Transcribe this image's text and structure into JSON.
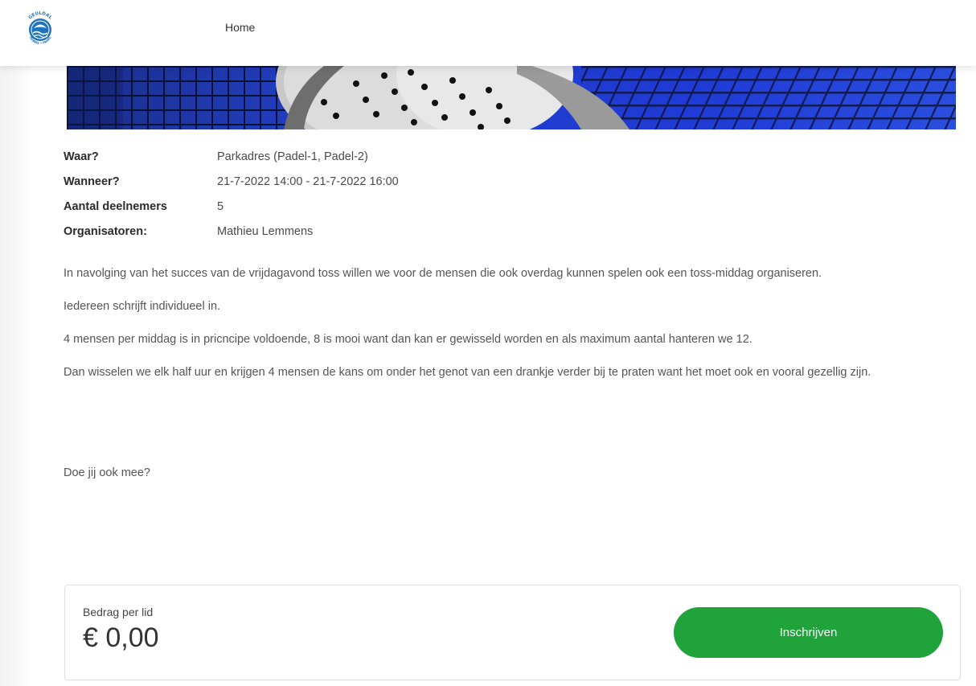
{
  "header": {
    "logo_text_top": "GEULDAL",
    "logo_text_bottom": "TENNIS • PADEL",
    "nav": {
      "home": "Home"
    }
  },
  "hero": {
    "image": "padel-racket-net-photo"
  },
  "details": [
    {
      "label": "Waar?",
      "value": "Parkadres (Padel-1, Padel-2)"
    },
    {
      "label": "Wanneer?",
      "value": "21-7-2022 14:00 - 21-7-2022 16:00"
    },
    {
      "label": "Aantal deelnemers",
      "value": "5"
    },
    {
      "label": "Organisatoren:",
      "value": "Mathieu Lemmens"
    }
  ],
  "description": [
    "In navolging van het succes van de vrijdagavond toss willen we voor de mensen die ook overdag kunnen spelen ook een toss-middag organiseren.",
    "Iedereen schrijft individueel in.",
    "4 mensen per middag is in pricncipe voldoende, 8 is mooi want dan kan er gewisseld worden en als maximum aantal hanteren we 12.",
    "Dan wisselen we elk half uur en krijgen 4 mensen de kans om onder het genot van een drankje verder bij te praten want het moet ook en vooral gezellig zijn."
  ],
  "closing": "Doe jij ook mee?",
  "pricing": {
    "label": "Bedrag per lid",
    "value": "€ 0,00",
    "button": "Inschrijven"
  },
  "colors": {
    "accent_green": "#21a33b",
    "logo_blue": "#1e73be",
    "hero_blue": "#1f3fcf"
  }
}
